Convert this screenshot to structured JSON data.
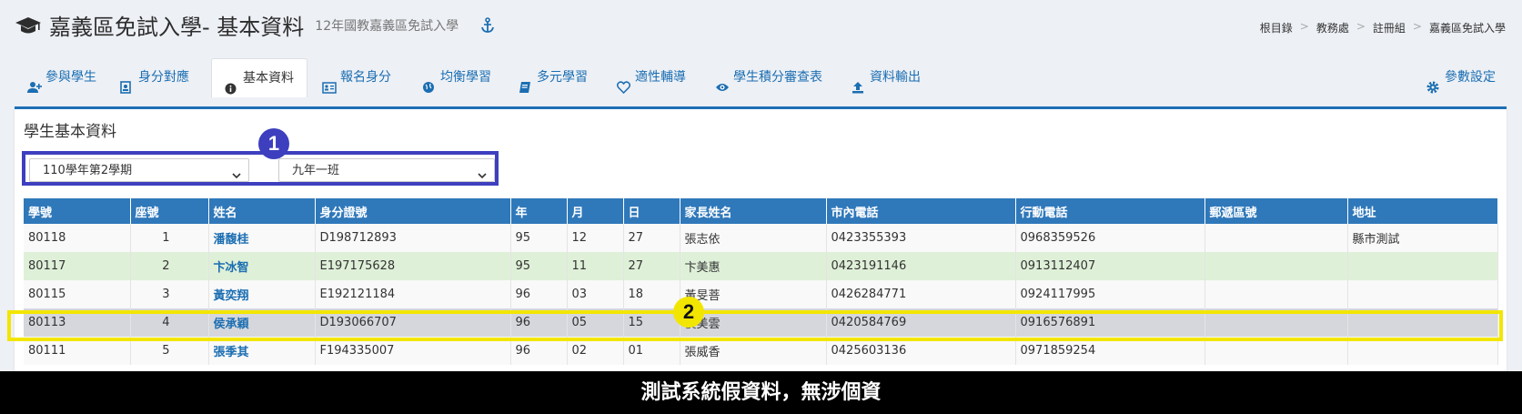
{
  "header": {
    "icon": "graduation-cap-icon",
    "title": "嘉義區免試入學- 基本資料",
    "subtitle": "12年國教嘉義區免試入學",
    "anchor_icon": "anchor-icon"
  },
  "breadcrumb": [
    "根目錄",
    "教務處",
    "註冊組",
    "嘉義區免試入學"
  ],
  "tabs": [
    {
      "label": "參與學生",
      "icon": "user-plus-icon"
    },
    {
      "label": "身分對應",
      "icon": "id-card-icon"
    },
    {
      "label": "基本資料",
      "icon": "info-circle-icon"
    },
    {
      "label": "報名身分",
      "icon": "address-card-icon"
    },
    {
      "label": "均衡學習",
      "icon": "globe-icon"
    },
    {
      "label": "多元學習",
      "icon": "book-icon"
    },
    {
      "label": "適性輔導",
      "icon": "heart-icon"
    },
    {
      "label": "學生積分審查表",
      "icon": "eye-icon"
    },
    {
      "label": "資料輸出",
      "icon": "upload-icon"
    }
  ],
  "settings_tab": {
    "label": "參數設定",
    "icon": "gear-icon"
  },
  "panel": {
    "title": "學生基本資料",
    "semester_select": "110學年第2學期",
    "class_select": "九年一班",
    "badge1": "1",
    "badge2": "2"
  },
  "table": {
    "headers": [
      "學號",
      "座號",
      "姓名",
      "身分證號",
      "年",
      "月",
      "日",
      "家長姓名",
      "市內電話",
      "行動電話",
      "郵遞區號",
      "地址"
    ],
    "rows": [
      [
        "80118",
        "1",
        "潘馥桂",
        "D198712893",
        "95",
        "12",
        "27",
        "張志依",
        "0423355393",
        "0968359526",
        "",
        "縣市測試"
      ],
      [
        "80117",
        "2",
        "卞冰智",
        "E197175628",
        "95",
        "11",
        "27",
        "卞美惠",
        "0423191146",
        "0913112407",
        "",
        ""
      ],
      [
        "80115",
        "3",
        "黃奕翔",
        "E192121184",
        "96",
        "03",
        "18",
        "黃旻菩",
        "0426284771",
        "0924117995",
        "",
        ""
      ],
      [
        "80113",
        "4",
        "侯承穎",
        "D193066707",
        "96",
        "05",
        "15",
        "侯美雲",
        "0420584769",
        "0916576891",
        "",
        ""
      ],
      [
        "80111",
        "5",
        "張季其",
        "F194335007",
        "96",
        "02",
        "01",
        "張威香",
        "0425603136",
        "0971859254",
        "",
        ""
      ]
    ]
  },
  "caption": "測試系統假資料，無涉個資",
  "colors": {
    "accent": "#1d6fb5",
    "header_bg": "#2f78ba",
    "box1": "#3d3fbf",
    "box2": "#f2e600",
    "green_row": "#dff0d8",
    "highlight_row": "#d5d7dc"
  }
}
